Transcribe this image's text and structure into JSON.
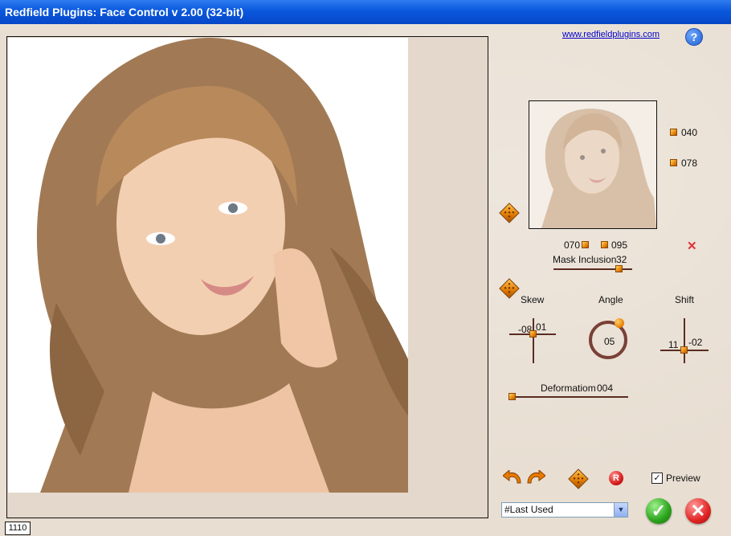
{
  "window": {
    "title": "Redfield Plugins: Face Control v 2.00 (32-bit)"
  },
  "header": {
    "link": "www.redfieldplugins.com",
    "help_label": "?"
  },
  "status": {
    "value": "1110"
  },
  "thumb_controls": {
    "right_top": "040",
    "right_bottom": "078",
    "bottom_left": "070",
    "bottom_right": "095"
  },
  "mask_inclusion": {
    "label": "Mask Inclusion",
    "value": "32"
  },
  "skew": {
    "label": "Skew",
    "x": "-08",
    "y": "01"
  },
  "angle": {
    "label": "Angle",
    "value": "05"
  },
  "shift": {
    "label": "Shift",
    "x": "11",
    "y": "-02"
  },
  "deformation": {
    "label": "Deformatiom",
    "value": "004"
  },
  "footer": {
    "preview_label": "Preview",
    "preview_checked": "✓",
    "preset_value": "#Last Used",
    "reset_label": "R"
  }
}
